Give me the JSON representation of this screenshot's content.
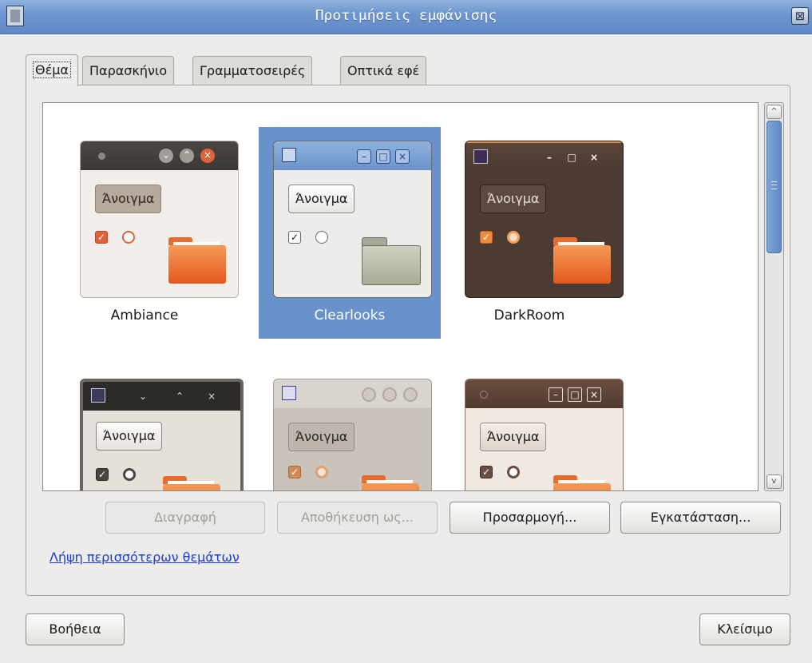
{
  "window": {
    "title": "Προτιμήσεις εμφάνισης",
    "close_glyph": "⊠"
  },
  "tabs": [
    {
      "label": "Θέμα",
      "active": true
    },
    {
      "label": "Παρασκήνιο",
      "active": false
    },
    {
      "label": "Γραμματοσειρές",
      "active": false
    },
    {
      "label": "Οπτικά εφέ",
      "active": false
    }
  ],
  "preview": {
    "button_label": "Άνοιγμα",
    "check_glyph": "✓",
    "win_min_glyph": "–",
    "win_max_glyph": "□",
    "win_close_glyph": "×",
    "win_down_glyph": "⌄",
    "win_up_glyph": "⌃"
  },
  "themes": [
    {
      "name": "Ambiance",
      "selected": false
    },
    {
      "name": "Clearlooks",
      "selected": true
    },
    {
      "name": "DarkRoom",
      "selected": false
    },
    {
      "name": "",
      "selected": false
    },
    {
      "name": "",
      "selected": false
    },
    {
      "name": "",
      "selected": false
    }
  ],
  "scrollbar": {
    "up_glyph": "^",
    "down_glyph": "v"
  },
  "actions": {
    "delete": "Διαγραφή",
    "save_as": "Αποθήκευση ως...",
    "customize": "Προσαρμογή...",
    "install": "Εγκατάσταση..."
  },
  "more_themes_link": "Λήψη περισσότερων θεμάτων",
  "footer": {
    "help": "Βοήθεια",
    "close": "Κλείσιμο"
  },
  "colors": {
    "titlebar": "#6f97cf",
    "selection": "#6792cc",
    "link": "#1a3fd6"
  }
}
